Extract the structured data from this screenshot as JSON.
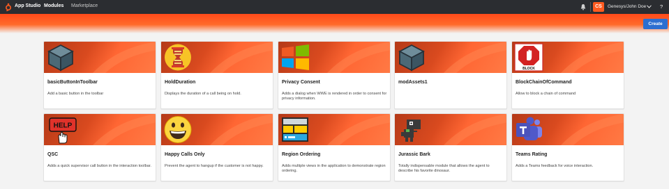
{
  "topbar": {
    "brand": "App Studio",
    "nav_modules": "Modules",
    "nav_marketplace": "Marketplace",
    "avatar_initials": "CS",
    "user": "Genesys/John Doe",
    "help": "?"
  },
  "toolbar": {
    "create_label": "Create"
  },
  "colors": {
    "accent": "#ff5a1f",
    "topbar": "#2b2d31",
    "primary_button": "#2c6fd1"
  },
  "cards": [
    {
      "icon": "cube-icon",
      "title": "basicButtonInToolbar",
      "description": "Add a basic button in the toolbar"
    },
    {
      "icon": "hourglass-icon",
      "title": "HoldDuration",
      "description": "Displays the duration of a call being on hold."
    },
    {
      "icon": "windows-logo-icon",
      "title": "Privacy Consent",
      "description": "Adds a dialog when WWE is rendered in order to consent for privacy information."
    },
    {
      "icon": "cube-icon",
      "title": "modAssets1",
      "description": ""
    },
    {
      "icon": "stop-sign-icon",
      "title": "BlockChainOfCommand",
      "description": "Allow to block a chain of command",
      "icon_text": "BLOCK"
    },
    {
      "icon": "help-hand-icon",
      "title": "QSC",
      "description": "Adds a quick supervisor call button in the interaction toolbar.",
      "icon_text": "HELP"
    },
    {
      "icon": "smiley-icon",
      "title": "Happy Calls Only",
      "description": "Prevent the agent to hangup if the customer is not happy."
    },
    {
      "icon": "layout-panels-icon",
      "title": "Region Ordering",
      "description": "Adds multiple views in the application to demonstrate region ordering."
    },
    {
      "icon": "dinosaur-icon",
      "title": "Jurassic Bark",
      "description": "Totally indispensable module that allows the agent to describe his favorite dinosaur."
    },
    {
      "icon": "teams-icon",
      "title": "Teams Rating",
      "description": "Adds a Teams feedback for voice interaction."
    }
  ]
}
